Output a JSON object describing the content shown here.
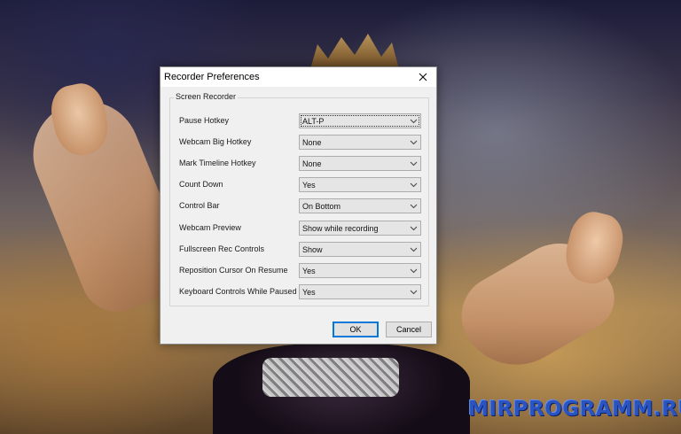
{
  "background": {
    "watermark": "MIRPROGRAMM.RU"
  },
  "dialog": {
    "title": "Recorder Preferences",
    "close_icon": "close-icon",
    "group_label": "Screen Recorder",
    "fields": [
      {
        "label": "Pause Hotkey",
        "value": "ALT-P",
        "focused": true
      },
      {
        "label": "Webcam Big Hotkey",
        "value": "None"
      },
      {
        "label": "Mark Timeline Hotkey",
        "value": "None"
      },
      {
        "label": "Count Down",
        "value": "Yes"
      },
      {
        "label": "Control Bar",
        "value": "On Bottom"
      },
      {
        "label": "Webcam Preview",
        "value": "Show while recording"
      },
      {
        "label": "Fullscreen Rec Controls",
        "value": "Show"
      },
      {
        "label": "Reposition Cursor On Resume",
        "value": "Yes"
      },
      {
        "label": "Keyboard Controls While Paused",
        "value": "Yes"
      }
    ],
    "ok_label": "OK",
    "cancel_label": "Cancel"
  },
  "colors": {
    "dialog_bg": "#f0f0f0",
    "default_button_border": "#0078d7",
    "watermark": "#2a55c0"
  }
}
